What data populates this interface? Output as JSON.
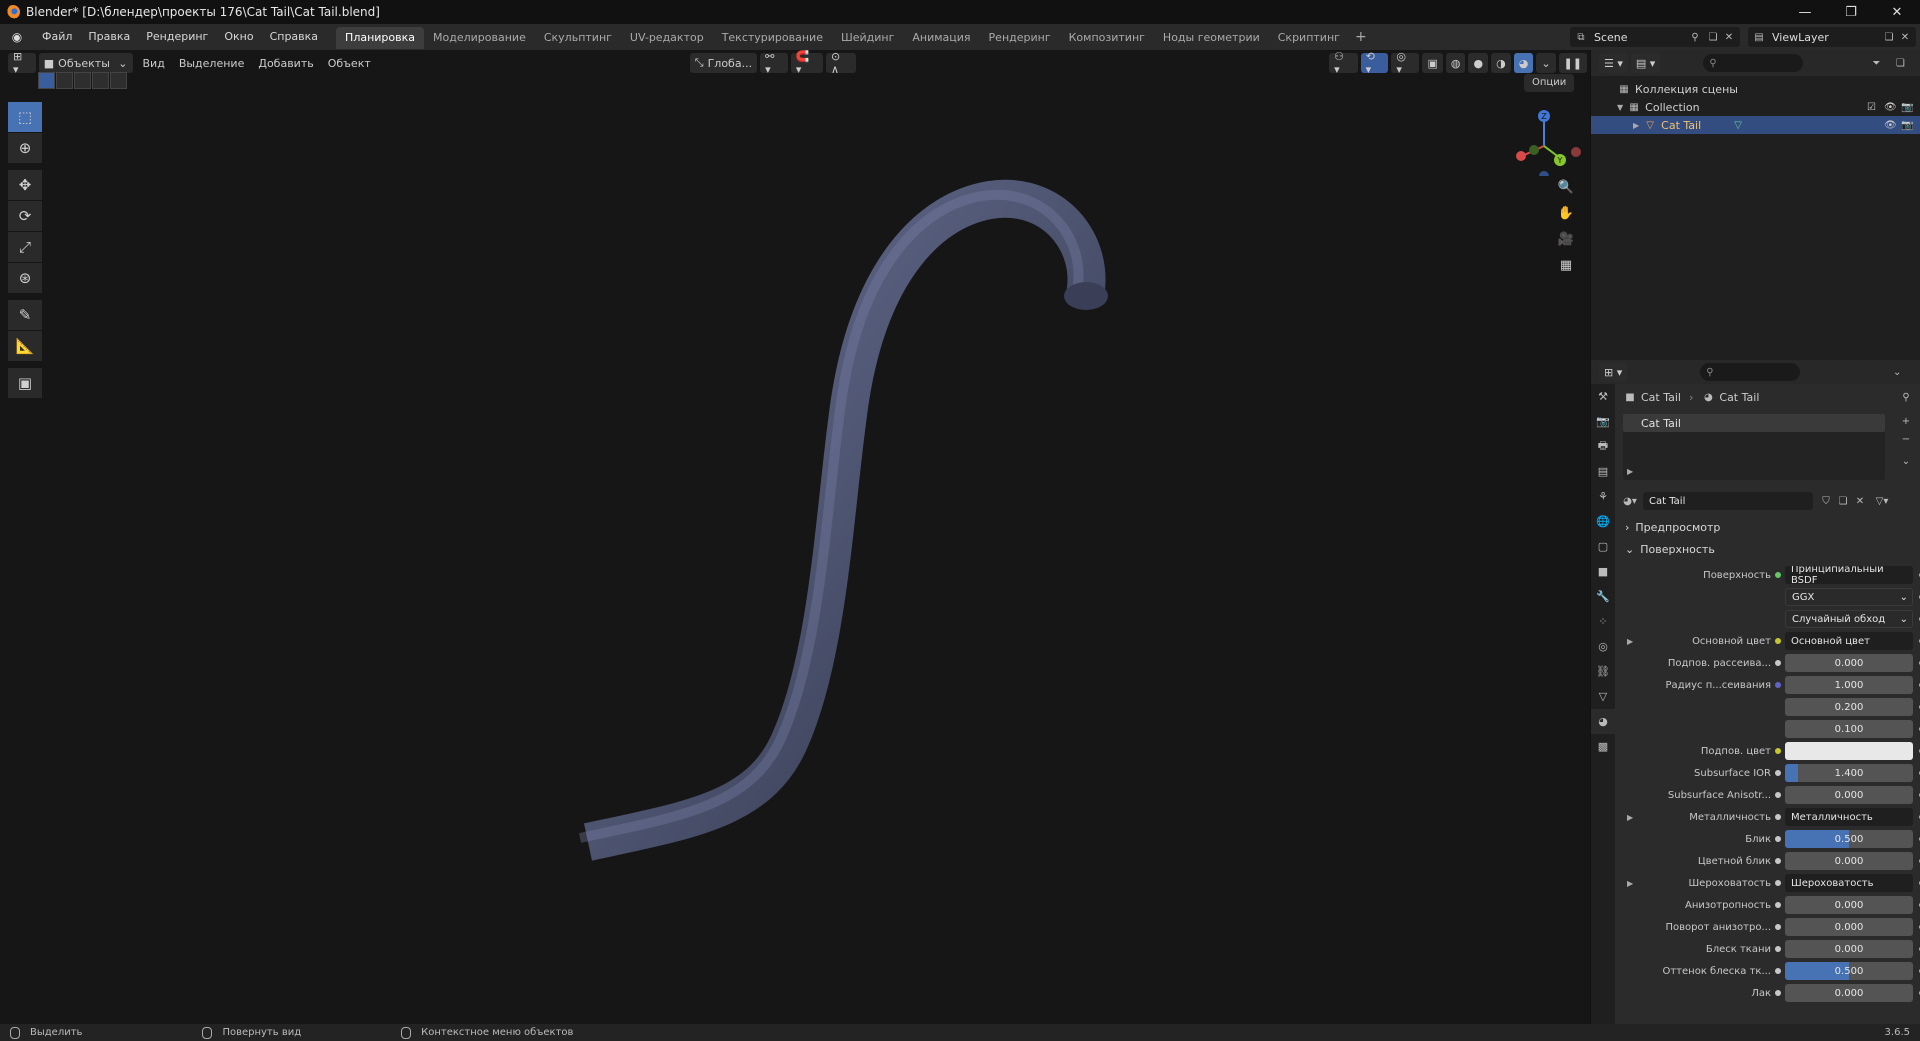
{
  "window": {
    "title": "Blender* [D:\\блендер\\проекты 176\\Cat Tail\\Cat Tail.blend]"
  },
  "menu": [
    "Файл",
    "Правка",
    "Рендеринг",
    "Окно",
    "Справка"
  ],
  "workspaces": [
    "Планировка",
    "Моделирование",
    "Скульптинг",
    "UV-редактор",
    "Текстурирование",
    "Шейдинг",
    "Анимация",
    "Рендеринг",
    "Композитинг",
    "Ноды геометрии",
    "Скриптинг"
  ],
  "active_workspace": "Планировка",
  "add_tab_label": "+",
  "scene": "Scene",
  "view_layer": "ViewLayer",
  "viewport": {
    "mode": "Объекты",
    "menus": [
      "Вид",
      "Выделение",
      "Добавить",
      "Объект"
    ],
    "transform_orientation": "Глоба...",
    "options_label": "Опции",
    "object_color": "#4d5470"
  },
  "gizmo": {
    "z": "Z",
    "y": "Y"
  },
  "outliner": {
    "root": "Коллекция сцены",
    "collection": "Collection",
    "object": "Cat Tail"
  },
  "properties": {
    "breadcrumb": [
      "Cat Tail",
      "Cat Tail"
    ],
    "slot": "Cat Tail",
    "material_name": "Cat Tail",
    "preview_label": "Предпросмотр",
    "surface_panel": "Поверхность",
    "rows": [
      {
        "label": "Поверхность",
        "value": "Принципиальный BSDF",
        "dot": "green",
        "kind": "dark"
      },
      {
        "label": "",
        "value": "GGX",
        "kind": "select"
      },
      {
        "label": "",
        "value": "Случайный обход",
        "kind": "select"
      },
      {
        "label": "Основной цвет",
        "value": "Основной цвет",
        "dot": "yellow",
        "kind": "dark",
        "expand": true
      },
      {
        "label": "Подпов. рассеива...",
        "value": "0.000",
        "kind": "num"
      },
      {
        "label": "Радиус п...сеивания",
        "value": "1.000",
        "dot": "purple",
        "kind": "num"
      },
      {
        "label": "",
        "value": "0.200",
        "kind": "num",
        "nodot": true
      },
      {
        "label": "",
        "value": "0.100",
        "kind": "num",
        "nodot": true
      },
      {
        "label": "Подпов. цвет",
        "value": "",
        "dot": "yellow",
        "kind": "white"
      },
      {
        "label": "Subsurface IOR",
        "value": "1.400",
        "kind": "num",
        "fill": 0.1
      },
      {
        "label": "Subsurface Anisotr...",
        "value": "0.000",
        "kind": "num"
      },
      {
        "label": "Металличность",
        "value": "Металличность",
        "kind": "dark",
        "expand": true
      },
      {
        "label": "Блик",
        "value": "0.500",
        "kind": "num",
        "fill": 0.5
      },
      {
        "label": "Цветной блик",
        "value": "0.000",
        "kind": "num"
      },
      {
        "label": "Шероховатость",
        "value": "Шероховатость",
        "kind": "dark",
        "expand": true
      },
      {
        "label": "Анизотропность",
        "value": "0.000",
        "kind": "num"
      },
      {
        "label": "Поворот анизотро...",
        "value": "0.000",
        "kind": "num"
      },
      {
        "label": "Блеск ткани",
        "value": "0.000",
        "kind": "num"
      },
      {
        "label": "Оттенок блеска тк...",
        "value": "0.500",
        "kind": "num",
        "fill": 0.5
      },
      {
        "label": "Лак",
        "value": "0.000",
        "kind": "num"
      }
    ]
  },
  "status": {
    "select": "Выделить",
    "rotate": "Повернуть вид",
    "context": "Контекстное меню объектов",
    "version": "3.6.5"
  }
}
